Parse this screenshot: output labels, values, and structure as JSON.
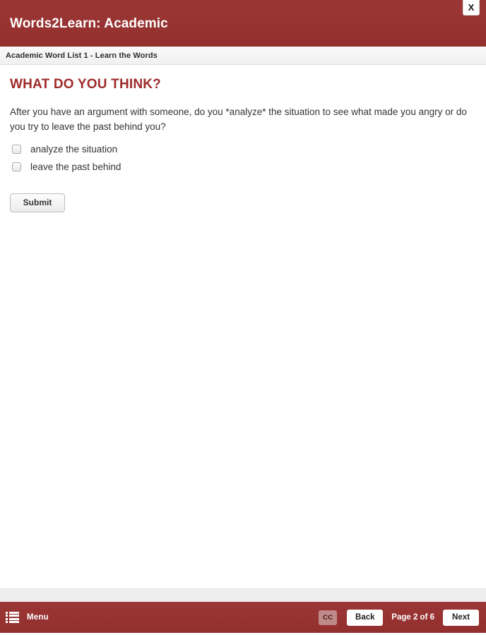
{
  "header": {
    "title": "Words2Learn: Academic",
    "close_label": "X"
  },
  "breadcrumb": {
    "text": "Academic Word List 1 - Learn the Words"
  },
  "main": {
    "heading": "WHAT DO YOU THINK?",
    "question": "After you have an argument with someone, do you *analyze* the situation to see what made you angry or do you try to leave the past behind you?",
    "options": [
      {
        "label": "analyze the situation",
        "checked": false
      },
      {
        "label": "leave the past behind",
        "checked": false
      }
    ],
    "submit_label": "Submit"
  },
  "footer": {
    "menu_label": "Menu",
    "cc_label": "CC",
    "back_label": "Back",
    "page_indicator": "Page 2 of 6",
    "next_label": "Next"
  },
  "colors": {
    "brand_red": "#97312f",
    "heading_red": "#9e2b2b",
    "cc_button": "#c08a88",
    "breadcrumb_bg": "#f6f6f6",
    "prefooter_bg": "#eeeeee"
  }
}
